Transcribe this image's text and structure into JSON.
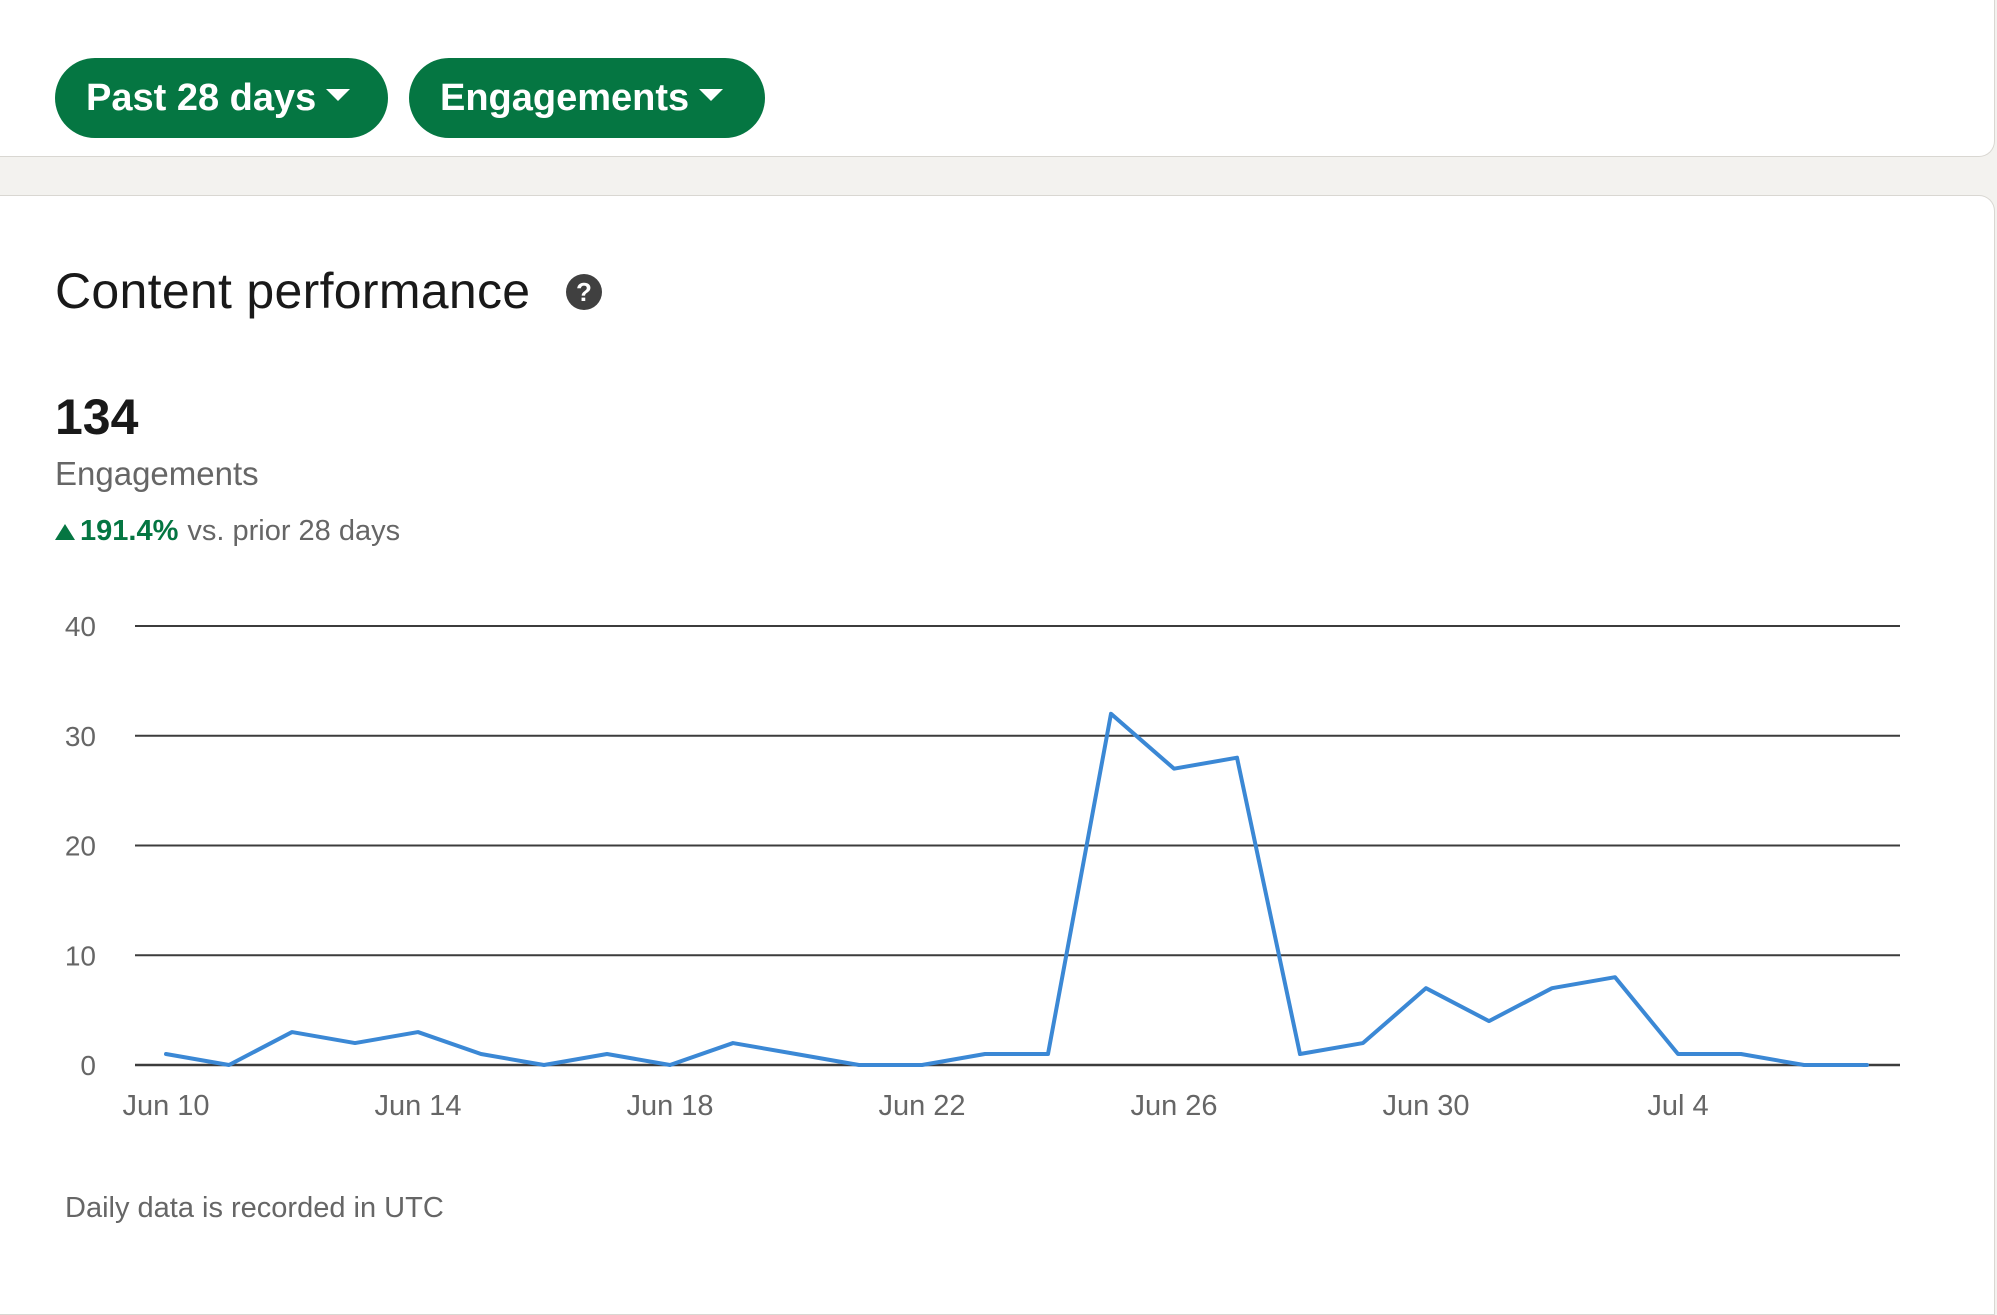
{
  "filters": {
    "range_label": "Past 28 days",
    "metric_label": "Engagements"
  },
  "section": {
    "title": "Content performance",
    "help_glyph": "?"
  },
  "summary": {
    "value": "134",
    "label": "Engagements",
    "change_value": "191.4%",
    "change_text": "vs. prior 28 days"
  },
  "colors": {
    "accent": "#057642",
    "line": "#3b88d5"
  },
  "chart_data": {
    "type": "line",
    "title": "",
    "xlabel": "",
    "ylabel": "",
    "ylim": [
      0,
      40
    ],
    "yticks": [
      0,
      10,
      20,
      30,
      40
    ],
    "grid": true,
    "x_tick_labels": [
      "Jun 10",
      "Jun 14",
      "Jun 18",
      "Jun 22",
      "Jun 26",
      "Jun 30",
      "Jul 4"
    ],
    "x_tick_indices": [
      0,
      4,
      8,
      12,
      16,
      20,
      24
    ],
    "x": [
      "Jun 10",
      "Jun 11",
      "Jun 12",
      "Jun 13",
      "Jun 14",
      "Jun 15",
      "Jun 16",
      "Jun 17",
      "Jun 18",
      "Jun 19",
      "Jun 20",
      "Jun 21",
      "Jun 22",
      "Jun 23",
      "Jun 24",
      "Jun 25",
      "Jun 26",
      "Jun 27",
      "Jun 28",
      "Jun 29",
      "Jun 30",
      "Jul 1",
      "Jul 2",
      "Jul 3",
      "Jul 4",
      "Jul 5",
      "Jul 6",
      "Jul 7"
    ],
    "series": [
      {
        "values": [
          1,
          0,
          3,
          2,
          3,
          1,
          0,
          1,
          0,
          2,
          1,
          0,
          0,
          1,
          1,
          32,
          27,
          28,
          1,
          2,
          7,
          4,
          7,
          8,
          1,
          1,
          0,
          0
        ]
      }
    ]
  },
  "footnote": "Daily data is recorded in UTC"
}
